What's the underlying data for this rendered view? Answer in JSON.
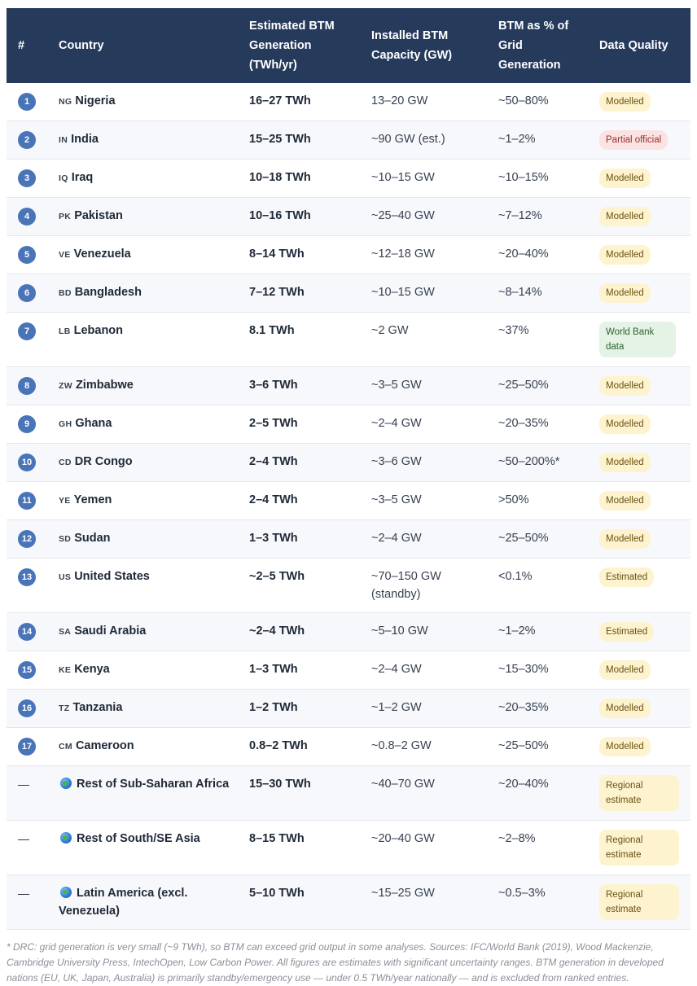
{
  "headers": {
    "rank": "#",
    "country": "Country",
    "generation": "Estimated BTM Generation (TWh/yr)",
    "capacity": "Installed BTM Capacity (GW)",
    "share": "BTM as % of Grid Generation",
    "quality": "Data Quality"
  },
  "rows": [
    {
      "rank": "1",
      "code": "NG",
      "country": "Nigeria",
      "generation": "16–27 TWh",
      "capacity": "13–20 GW",
      "share": "~50–80%",
      "quality": "Modelled",
      "qtype": "modelled"
    },
    {
      "rank": "2",
      "code": "IN",
      "country": "India",
      "generation": "15–25 TWh",
      "capacity": "~90 GW (est.)",
      "share": "~1–2%",
      "quality": "Partial official",
      "qtype": "partial"
    },
    {
      "rank": "3",
      "code": "IQ",
      "country": "Iraq",
      "generation": "10–18 TWh",
      "capacity": "~10–15 GW",
      "share": "~10–15%",
      "quality": "Modelled",
      "qtype": "modelled"
    },
    {
      "rank": "4",
      "code": "PK",
      "country": "Pakistan",
      "generation": "10–16 TWh",
      "capacity": "~25–40 GW",
      "share": "~7–12%",
      "quality": "Modelled",
      "qtype": "modelled"
    },
    {
      "rank": "5",
      "code": "VE",
      "country": "Venezuela",
      "generation": "8–14 TWh",
      "capacity": "~12–18 GW",
      "share": "~20–40%",
      "quality": "Modelled",
      "qtype": "modelled"
    },
    {
      "rank": "6",
      "code": "BD",
      "country": "Bangladesh",
      "generation": "7–12 TWh",
      "capacity": "~10–15 GW",
      "share": "~8–14%",
      "quality": "Modelled",
      "qtype": "modelled"
    },
    {
      "rank": "7",
      "code": "LB",
      "country": "Lebanon",
      "generation": "8.1 TWh",
      "capacity": "~2 GW",
      "share": "~37%",
      "quality": "World Bank data",
      "qtype": "worldbank"
    },
    {
      "rank": "8",
      "code": "ZW",
      "country": "Zimbabwe",
      "generation": "3–6 TWh",
      "capacity": "~3–5 GW",
      "share": "~25–50%",
      "quality": "Modelled",
      "qtype": "modelled"
    },
    {
      "rank": "9",
      "code": "GH",
      "country": "Ghana",
      "generation": "2–5 TWh",
      "capacity": "~2–4 GW",
      "share": "~20–35%",
      "quality": "Modelled",
      "qtype": "modelled"
    },
    {
      "rank": "10",
      "code": "CD",
      "country": "DR Congo",
      "generation": "2–4 TWh",
      "capacity": "~3–6 GW",
      "share": "~50–200%*",
      "quality": "Modelled",
      "qtype": "modelled"
    },
    {
      "rank": "11",
      "code": "YE",
      "country": "Yemen",
      "generation": "2–4 TWh",
      "capacity": "~3–5 GW",
      "share": ">50%",
      "quality": "Modelled",
      "qtype": "modelled"
    },
    {
      "rank": "12",
      "code": "SD",
      "country": "Sudan",
      "generation": "1–3 TWh",
      "capacity": "~2–4 GW",
      "share": "~25–50%",
      "quality": "Modelled",
      "qtype": "modelled"
    },
    {
      "rank": "13",
      "code": "US",
      "country": "United States",
      "generation": "~2–5 TWh",
      "capacity": "~70–150 GW (standby)",
      "share": "<0.1%",
      "quality": "Estimated",
      "qtype": "estimated"
    },
    {
      "rank": "14",
      "code": "SA",
      "country": "Saudi Arabia",
      "generation": "~2–4 TWh",
      "capacity": "~5–10 GW",
      "share": "~1–2%",
      "quality": "Estimated",
      "qtype": "estimated"
    },
    {
      "rank": "15",
      "code": "KE",
      "country": "Kenya",
      "generation": "1–3 TWh",
      "capacity": "~2–4 GW",
      "share": "~15–30%",
      "quality": "Modelled",
      "qtype": "modelled"
    },
    {
      "rank": "16",
      "code": "TZ",
      "country": "Tanzania",
      "generation": "1–2 TWh",
      "capacity": "~1–2 GW",
      "share": "~20–35%",
      "quality": "Modelled",
      "qtype": "modelled"
    },
    {
      "rank": "17",
      "code": "CM",
      "country": "Cameroon",
      "generation": "0.8–2 TWh",
      "capacity": "~0.8–2 GW",
      "share": "~25–50%",
      "quality": "Modelled",
      "qtype": "modelled"
    },
    {
      "rank": "—",
      "code": "",
      "icon": "globe-icon",
      "country": "Rest of Sub-Saharan Africa",
      "generation": "15–30 TWh",
      "capacity": "~40–70 GW",
      "share": "~20–40%",
      "quality": "Regional estimate",
      "qtype": "regional"
    },
    {
      "rank": "—",
      "code": "",
      "icon": "globe-icon",
      "country": "Rest of South/SE Asia",
      "generation": "8–15 TWh",
      "capacity": "~20–40 GW",
      "share": "~2–8%",
      "quality": "Regional estimate",
      "qtype": "regional"
    },
    {
      "rank": "—",
      "code": "",
      "icon": "globe-icon",
      "country": "Latin America (excl. Venezuela)",
      "generation": "5–10 TWh",
      "capacity": "~15–25 GW",
      "share": "~0.5–3%",
      "quality": "Regional estimate",
      "qtype": "regional"
    }
  ],
  "footnote": "* DRC: grid generation is very small (~9 TWh), so BTM can exceed grid output in some analyses. Sources: IFC/World Bank (2019), Wood Mackenzie, Cambridge University Press, IntechOpen, Low Carbon Power. All figures are estimates with significant uncertainty ranges. BTM generation in developed nations (EU, UK, Japan, Australia) is primarily standby/emergency use — under 0.5 TWh/year nationally — and is excluded from ranked entries.",
  "colors": {
    "header_bg": "#263a5c",
    "rank_badge": "#4a74b8",
    "modelled_bg": "#fdf3cf",
    "partial_bg": "#fbe3e3",
    "worldbank_bg": "#e5f3e6"
  }
}
